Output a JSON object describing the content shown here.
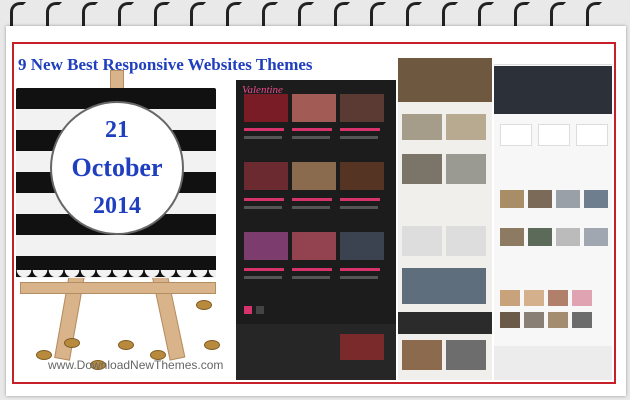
{
  "title": "9 New Best Responsive Websites Themes",
  "date": {
    "day": "21",
    "month": "October",
    "year": "2014"
  },
  "watermark": "www.DownloadNewThemes.com",
  "theme_logo": "Valentine",
  "colors": {
    "border": "#c8202a",
    "title": "#1f3fbf",
    "panel_dark": "#1c1c1c",
    "accent_pink": "#d6336c"
  }
}
